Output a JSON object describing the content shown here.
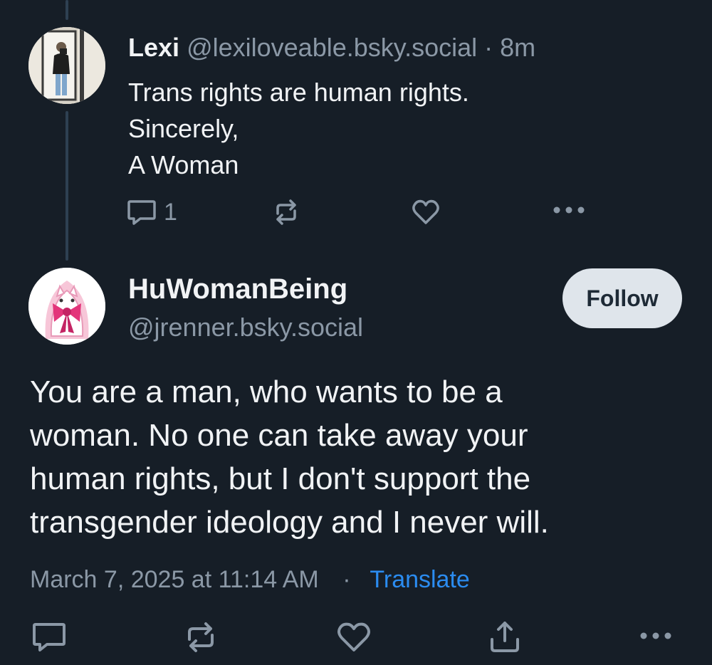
{
  "parent_post": {
    "display_name": "Lexi",
    "handle": "@lexiloveable.bsky.social",
    "separator": "·",
    "time": "8m",
    "lines": [
      "Trans rights are human rights.",
      "Sincerely,",
      "A Woman"
    ],
    "reply_count": "1",
    "icons": [
      "reply-icon",
      "repost-icon",
      "like-icon",
      "more-icon"
    ]
  },
  "main_post": {
    "display_name": "HuWomanBeing",
    "handle": "@jrenner.bsky.social",
    "follow_label": "Follow",
    "lines": [
      "You are a man, who wants to be a",
      "woman. No one can take away your",
      "human rights, but I don't support the",
      "transgender ideology and I never will."
    ],
    "date": "March 7, 2025 at 11:14 AM",
    "separator": "·",
    "translate_label": "Translate",
    "icons": [
      "reply-icon",
      "repost-icon",
      "like-icon",
      "share-icon",
      "more-icon"
    ]
  },
  "colors": {
    "background": "#161e27",
    "text": "#f1f3f5",
    "muted": "#8b98a6",
    "link": "#2b8cf0",
    "follow_bg": "#dfe5eb",
    "thread_line": "#2e4052"
  }
}
